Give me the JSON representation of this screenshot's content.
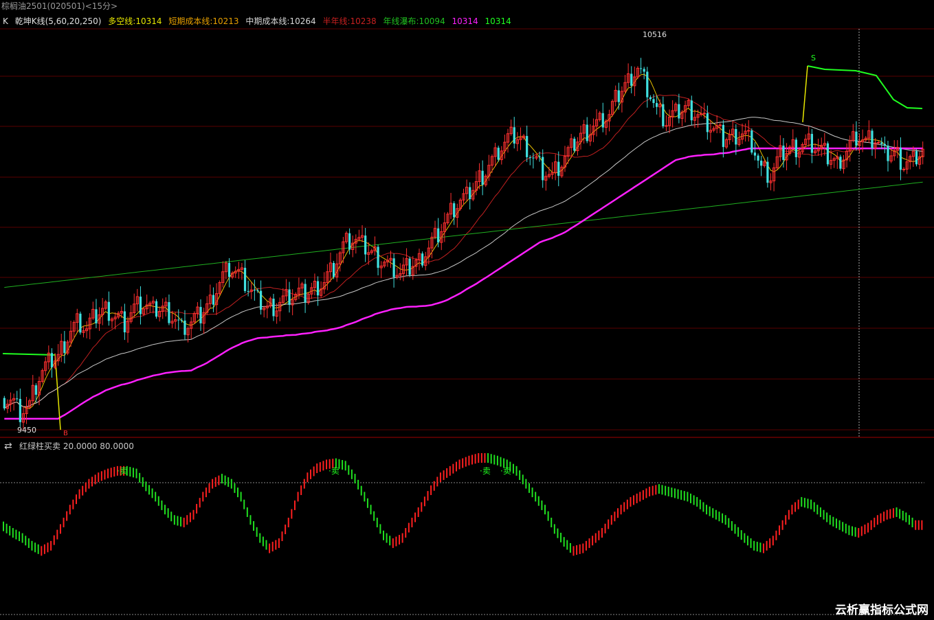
{
  "title": "棕榈油2501(020501)<15分>",
  "legend": {
    "prefix": "K",
    "name": "乾坤K线(5,60,20,250)",
    "items": [
      {
        "label": "多空线:10314",
        "color": "#e8e800"
      },
      {
        "label": "短期成本线:10213",
        "color": "#e8a000"
      },
      {
        "label": "中期成本线:10264",
        "color": "#d0d0d0"
      },
      {
        "label": "半年线:10238",
        "color": "#c82020"
      },
      {
        "label": "年线瀑布:10094",
        "color": "#20c020"
      },
      {
        "label": "10314",
        "color": "#ff20ff"
      },
      {
        "label": "10314",
        "color": "#20ff20"
      }
    ]
  },
  "price_markers": {
    "high": "10516",
    "low": "9450",
    "buy_signal": "B",
    "sell_signal": "S"
  },
  "indicator": {
    "swap_icon": "swap-icon",
    "label": "红绿柱买卖 20.0000 80.0000",
    "sell_label": "卖"
  },
  "watermark": "云析赢指标公式网",
  "colors": {
    "up": "#ff3030",
    "down": "#40e0e0",
    "ma_short": "#e8c000",
    "ma_mid": "#c02020",
    "ma_long": "#c8c8c8",
    "ma_year": "#20b020",
    "magenta": "#ff20ff",
    "green_bright": "#20ff20",
    "grid": "#5a0000"
  },
  "chart_data": {
    "type": "candlestick",
    "y_range": [
      9400,
      10560
    ],
    "close_series": [
      9500,
      9460,
      9480,
      9560,
      9600,
      9620,
      9680,
      9720,
      9700,
      9740,
      9760,
      9740,
      9720,
      9760,
      9770,
      9750,
      9760,
      9740,
      9700,
      9720,
      9740,
      9780,
      9840,
      9880,
      9860,
      9820,
      9780,
      9760,
      9770,
      9790,
      9800,
      9800,
      9820,
      9840,
      9880,
      9940,
      9960,
      9940,
      9920,
      9900,
      9880,
      9860,
      9880,
      9900,
      9940,
      9980,
      10020,
      10060,
      10080,
      10120,
      10160,
      10200,
      10240,
      10260,
      10240,
      10200,
      10160,
      10140,
      10180,
      10220,
      10260,
      10280,
      10300,
      10320,
      10380,
      10420,
      10460,
      10400,
      10330,
      10300,
      10320,
      10340,
      10330,
      10300,
      10280,
      10250,
      10260,
      10270,
      10240,
      10160,
      10140,
      10200,
      10220,
      10230,
      10240,
      10220,
      10200,
      10180,
      10220,
      10260,
      10240,
      10250,
      10200,
      10210,
      10180,
      10190,
      10220
    ],
    "oscillator": [
      47,
      42,
      38,
      32,
      28,
      32,
      45,
      60,
      72,
      80,
      85,
      88,
      90,
      90,
      88,
      78,
      70,
      60,
      52,
      50,
      56,
      70,
      80,
      84,
      80,
      70,
      52,
      38,
      30,
      34,
      50,
      70,
      85,
      92,
      95,
      96,
      94,
      84,
      70,
      55,
      40,
      34,
      38,
      50,
      62,
      75,
      85,
      90,
      95,
      98,
      100,
      100,
      98,
      95,
      90,
      80,
      70,
      60,
      45,
      35,
      28,
      30,
      36,
      42,
      52,
      60,
      66,
      70,
      74,
      76,
      74,
      72,
      70,
      66,
      60,
      56,
      52,
      45,
      38,
      32,
      30,
      36,
      48,
      60,
      66,
      64,
      58,
      52,
      48,
      44,
      42,
      46,
      52,
      56,
      58,
      54,
      48
    ]
  }
}
